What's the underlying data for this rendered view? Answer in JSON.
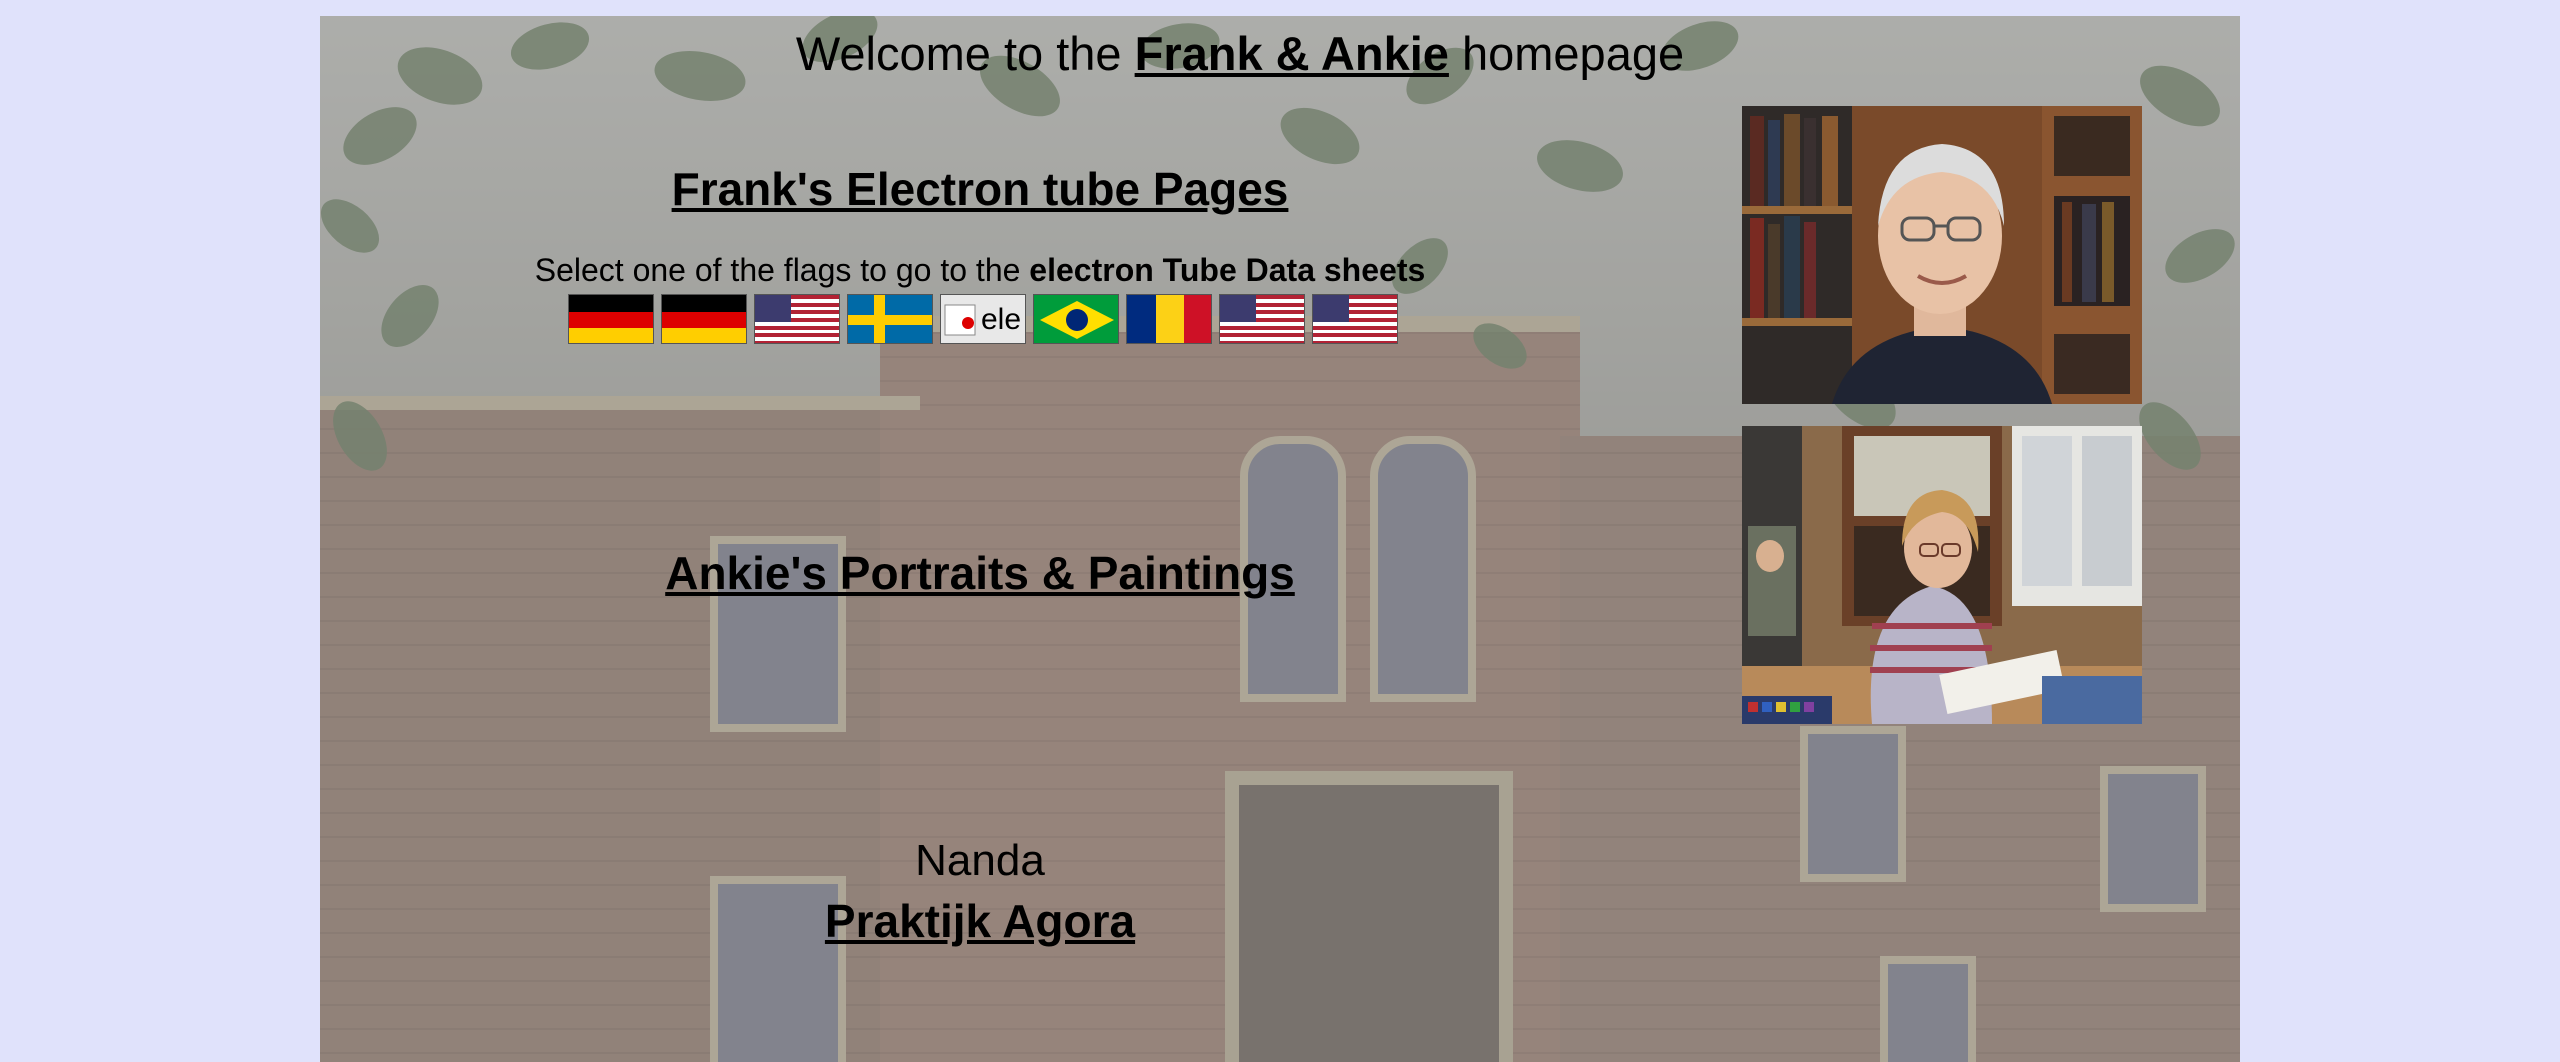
{
  "header": {
    "welcome_prefix": "Welcome to the ",
    "welcome_link": "Frank & Ankie",
    "welcome_suffix": " homepage"
  },
  "frank": {
    "link_label": "Frank's Electron tube Pages",
    "select_prefix": "Select one of the flags to go to the ",
    "select_bold": "electron Tube Data sheets"
  },
  "flags": [
    {
      "icon": "german-flag-icon"
    },
    {
      "icon": "german-flag-icon"
    },
    {
      "icon": "us-flag-icon"
    },
    {
      "icon": "swedish-flag-icon"
    },
    {
      "icon": "japanese-flag-broken-image",
      "alt_text": "ele"
    },
    {
      "icon": "brazilian-flag-icon"
    },
    {
      "icon": "romanian-flag-icon"
    },
    {
      "icon": "us-flag-icon"
    },
    {
      "icon": "us-flag-icon"
    }
  ],
  "ankie": {
    "link_label": "Ankie's Portraits & Paintings"
  },
  "footer": {
    "nanda": "Nanda",
    "praktijk_link": "Praktijk Agora"
  },
  "colors": {
    "page_background": "#e0e2fb",
    "text": "#000000"
  }
}
